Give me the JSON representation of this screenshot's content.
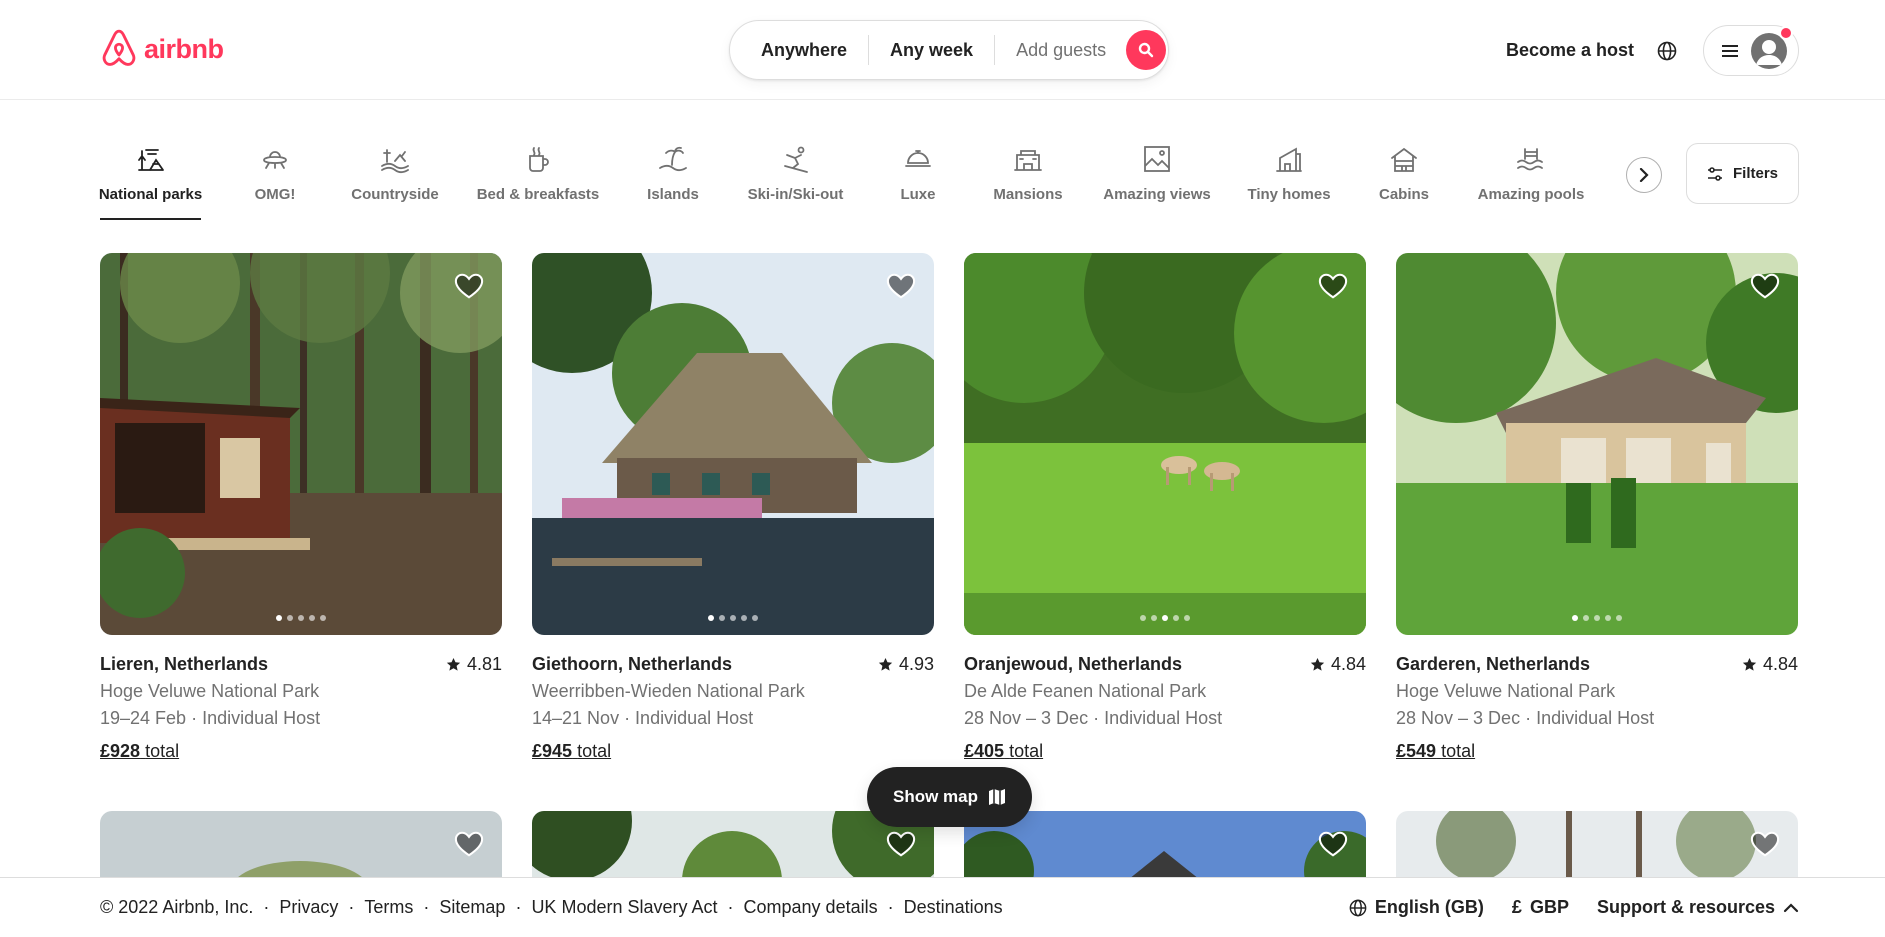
{
  "brand": {
    "name": "airbnb",
    "color": "#ff385c"
  },
  "search": {
    "anywhere": "Anywhere",
    "any_week": "Any week",
    "add_guests": "Add guests"
  },
  "header": {
    "become_host": "Become a host"
  },
  "categories": [
    {
      "label": "National parks",
      "icon": "national-parks-icon",
      "active": true
    },
    {
      "label": "OMG!",
      "icon": "ufo-icon"
    },
    {
      "label": "Countryside",
      "icon": "countryside-icon"
    },
    {
      "label": "Bed & breakfasts",
      "icon": "coffee-cup-icon"
    },
    {
      "label": "Islands",
      "icon": "island-icon"
    },
    {
      "label": "Ski-in/Ski-out",
      "icon": "skier-icon"
    },
    {
      "label": "Luxe",
      "icon": "cloche-icon"
    },
    {
      "label": "Mansions",
      "icon": "mansion-icon"
    },
    {
      "label": "Amazing views",
      "icon": "picture-icon"
    },
    {
      "label": "Tiny homes",
      "icon": "tiny-home-icon"
    },
    {
      "label": "Cabins",
      "icon": "cabin-icon"
    },
    {
      "label": "Amazing pools",
      "icon": "pool-icon"
    }
  ],
  "filters_label": "Filters",
  "listings": [
    {
      "title": "Lieren, Netherlands",
      "rating": "4.81",
      "park": "Hoge Veluwe National Park",
      "dates_host": "19–24 Feb · Individual Host",
      "price": "£928",
      "price_suffix": "total"
    },
    {
      "title": "Giethoorn, Netherlands",
      "rating": "4.93",
      "park": "Weerribben-Wieden National Park",
      "dates_host": "14–21 Nov · Individual Host",
      "price": "£945",
      "price_suffix": "total"
    },
    {
      "title": "Oranjewoud, Netherlands",
      "rating": "4.84",
      "park": "De Alde Feanen National Park",
      "dates_host": "28 Nov – 3 Dec · Individual Host",
      "price": "£405",
      "price_suffix": "total"
    },
    {
      "title": "Garderen, Netherlands",
      "rating": "4.84",
      "park": "Hoge Veluwe National Park",
      "dates_host": "28 Nov – 3 Dec · Individual Host",
      "price": "£549",
      "price_suffix": "total"
    }
  ],
  "show_map": "Show map",
  "footer": {
    "copyright": "© 2022 Airbnb, Inc.",
    "links": [
      "Privacy",
      "Terms",
      "Sitemap",
      "UK Modern Slavery Act",
      "Company details",
      "Destinations"
    ],
    "language": "English (GB)",
    "currency_symbol": "£",
    "currency": "GBP",
    "support": "Support & resources"
  }
}
